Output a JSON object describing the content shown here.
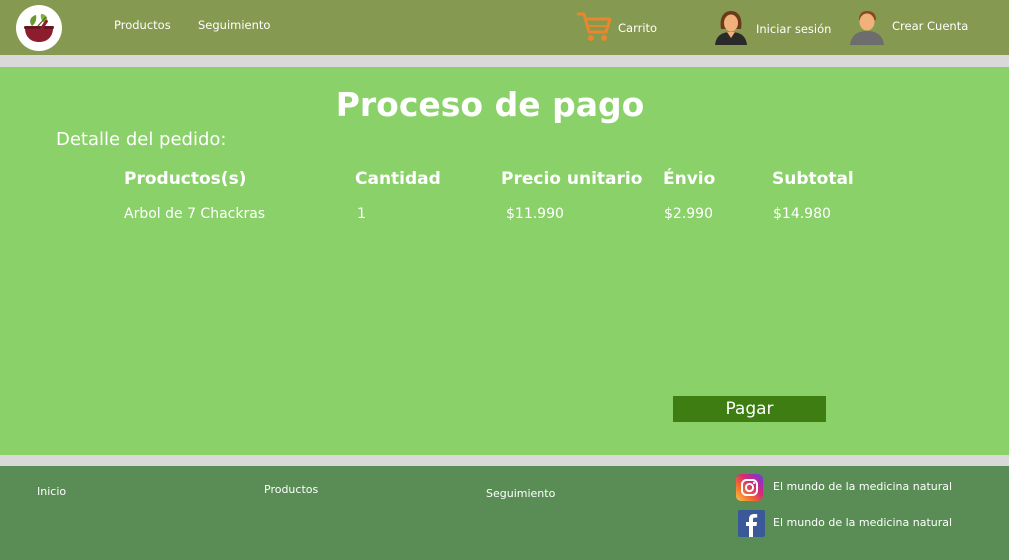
{
  "header": {
    "logo_icon": "mortar-herbs-icon",
    "nav": [
      "Productos",
      "Seguimiento"
    ],
    "cart_label": "Carrito",
    "login_label": "Iniciar sesión",
    "signup_label": "Crear Cuenta"
  },
  "main": {
    "title": "Proceso de pago",
    "section_label": "Detalle del pedido:",
    "columns": [
      "Productos(s)",
      "Cantidad",
      "Precio unitario",
      "Énvio",
      "Subtotal"
    ],
    "rows": [
      [
        "Arbol de 7 Chackras",
        "1",
        "$11.990",
        "$2.990",
        "$14.980"
      ]
    ],
    "pay_label": "Pagar"
  },
  "footer": {
    "links": [
      "Inicio",
      "Productos",
      "Seguimiento"
    ],
    "instagram_label": "El mundo de la medicina natural",
    "facebook_label": "El mundo de la medicina natural"
  },
  "colors": {
    "header_bg": "#869950",
    "main_bg": "#8ad16a",
    "footer_bg": "#5a8d55",
    "pay_button": "#3d7d11",
    "separator": "#d9d9d9",
    "cart": "#e8872c"
  }
}
